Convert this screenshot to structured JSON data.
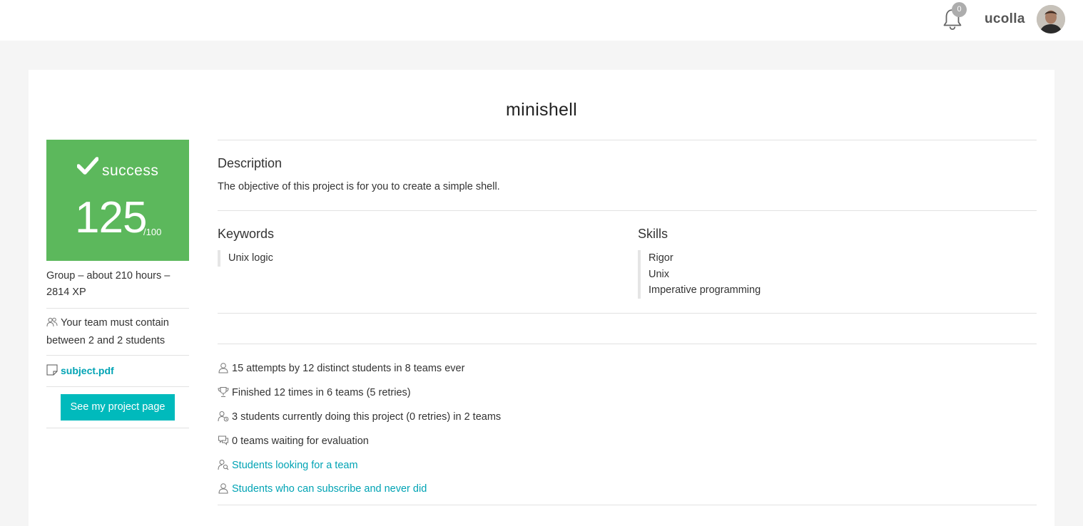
{
  "header": {
    "notifications_count": "0",
    "username": "ucolla"
  },
  "project": {
    "title": "minishell",
    "status": {
      "label": "success",
      "score": "125",
      "max": "/100",
      "color": "#5cb85c"
    },
    "meta": "Group – about 210 hours – 2814 XP",
    "team_rule": "Your team must contain between 2 and 2 students",
    "subject_link": "subject.pdf",
    "project_page_button": "See my project page",
    "description": {
      "heading": "Description",
      "text": "The objective of this project is for you to create a simple shell."
    },
    "keywords": {
      "heading": "Keywords",
      "items": [
        "Unix logic"
      ]
    },
    "skills": {
      "heading": "Skills",
      "items": [
        "Rigor",
        "Unix",
        "Imperative programming"
      ]
    },
    "stats": [
      {
        "icon": "user-icon",
        "text": "15 attempts by 12 distinct students in 8 teams ever",
        "link": false
      },
      {
        "icon": "trophy-icon",
        "text": "Finished 12 times in 6 teams (5 retries)",
        "link": false
      },
      {
        "icon": "user-working-icon",
        "text": "3 students currently doing this project (0 retries) in 2 teams",
        "link": false
      },
      {
        "icon": "speech-bubbles-icon",
        "text": "0 teams waiting for evaluation",
        "link": false
      },
      {
        "icon": "user-search-icon",
        "text": "Students looking for a team",
        "link": true
      },
      {
        "icon": "user-icon",
        "text": "Students who can subscribe and never did",
        "link": true
      }
    ]
  },
  "colors": {
    "accent": "#00babc",
    "link": "#00a3b4",
    "success": "#5cb85c"
  }
}
